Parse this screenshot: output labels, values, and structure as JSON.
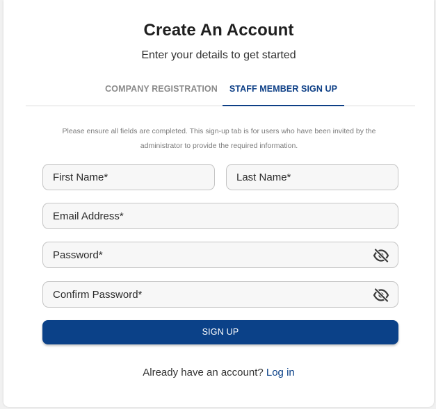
{
  "header": {
    "title": "Create An Account",
    "subtitle": "Enter your details to get started"
  },
  "tabs": [
    {
      "label": "COMPANY REGISTRATION",
      "active": false
    },
    {
      "label": "STAFF MEMBER SIGN UP",
      "active": true
    }
  ],
  "notice": "Please ensure all fields are completed. This sign-up tab is for users who have been invited by the administrator to provide the required information.",
  "form": {
    "first_name": {
      "label": "First Name",
      "required_mark": "*"
    },
    "last_name": {
      "label": "Last Name",
      "required_mark": "*"
    },
    "email": {
      "label": "Email Address",
      "required_mark": "*"
    },
    "password": {
      "label": "Password",
      "required_mark": "*",
      "icon": "eye-off-icon"
    },
    "confirm_password": {
      "label": "Confirm Password",
      "required_mark": "*",
      "icon": "eye-off-icon"
    },
    "submit_label": "SIGN UP"
  },
  "footer": {
    "prompt": "Already have an account?",
    "link_label": "Log in"
  },
  "colors": {
    "accent": "#0b4188",
    "active_tab": "#0d3f86",
    "inactive_tab": "#8a8a8a"
  }
}
